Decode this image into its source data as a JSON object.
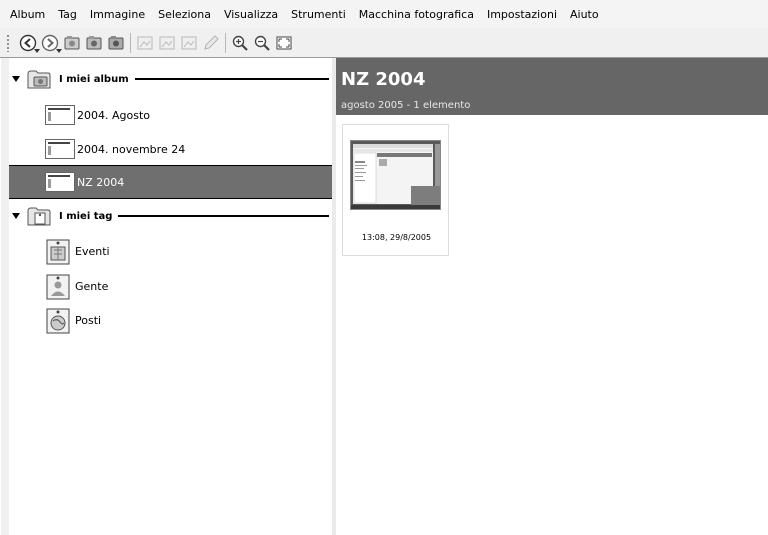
{
  "menu": [
    "Album",
    "Tag",
    "Immagine",
    "Seleziona",
    "Visualizza",
    "Strumenti",
    "Macchina fotografica",
    "Impostazioni",
    "Aiuto"
  ],
  "toolbar": {
    "buttons": [
      "back-icon",
      "forward-icon",
      "album-new-icon",
      "album-properties-icon",
      "album-delete-icon",
      "image-properties-icon",
      "image-edit-icon",
      "image-delete-icon",
      "pencil-icon",
      "zoom-in-icon",
      "zoom-out-icon",
      "fullscreen-icon"
    ]
  },
  "sidebar": {
    "albums_header": "I miei album",
    "albums": [
      {
        "label": "2004. Agosto"
      },
      {
        "label": "2004. novembre 24"
      },
      {
        "label": "NZ 2004",
        "selected": true
      }
    ],
    "tags_header": "I miei tag",
    "tags": [
      {
        "label": "Eventi",
        "icon": "events-tag-icon"
      },
      {
        "label": "Gente",
        "icon": "people-tag-icon"
      },
      {
        "label": "Posti",
        "icon": "places-tag-icon"
      }
    ]
  },
  "main": {
    "title": "NZ 2004",
    "subtitle": "agosto 2005 - 1 elemento",
    "photos": [
      {
        "caption": "13:08, 29/8/2005"
      }
    ]
  },
  "colors": {
    "header_band": "#666666",
    "selected_row": "#6f6f6f"
  }
}
